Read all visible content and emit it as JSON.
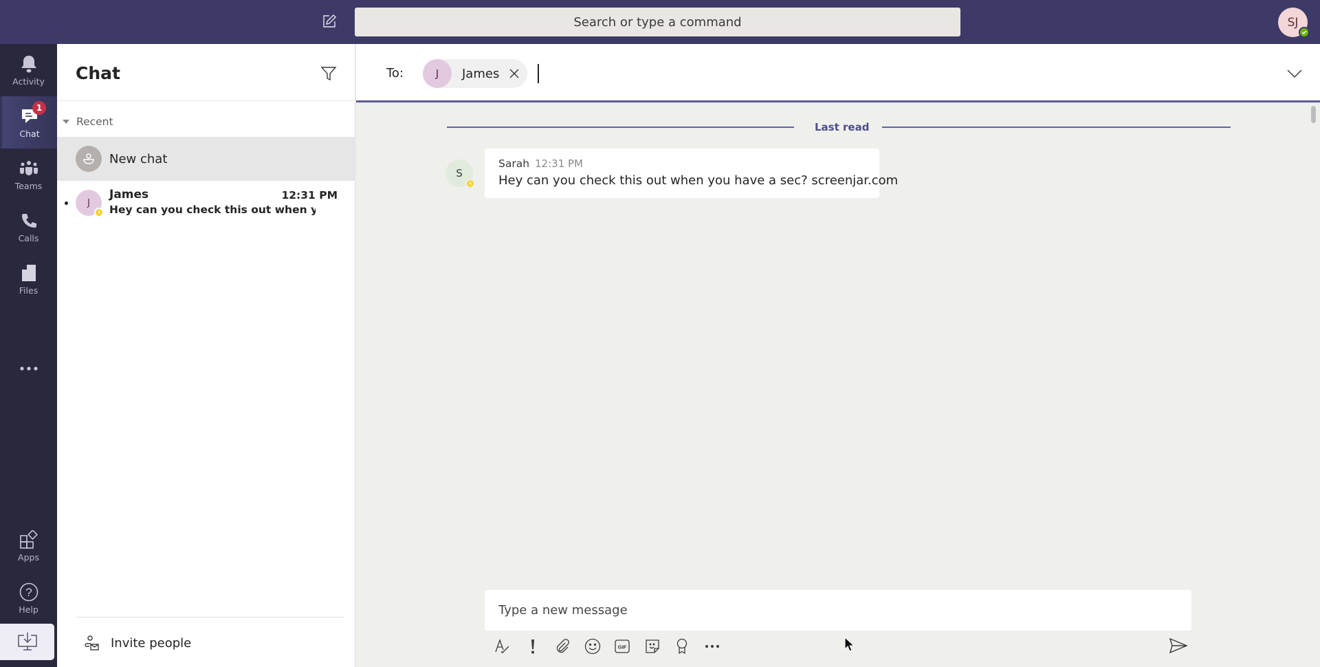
{
  "header": {
    "search_placeholder": "Search or type a command",
    "compose_icon": "new-chat-compose-icon",
    "user_initials": "SJ",
    "user_status": "available"
  },
  "rail": {
    "items": [
      {
        "id": "activity",
        "label": "Activity",
        "icon": "bell-icon"
      },
      {
        "id": "chat",
        "label": "Chat",
        "icon": "chat-icon",
        "badge": "1",
        "active": true
      },
      {
        "id": "teams",
        "label": "Teams",
        "icon": "teams-icon"
      },
      {
        "id": "calls",
        "label": "Calls",
        "icon": "phone-icon"
      },
      {
        "id": "files",
        "label": "Files",
        "icon": "file-icon"
      }
    ],
    "more_icon": "ellipsis-icon",
    "bottom_items": [
      {
        "id": "apps",
        "label": "Apps",
        "icon": "apps-icon"
      },
      {
        "id": "help",
        "label": "Help",
        "icon": "help-icon"
      }
    ],
    "download_icon": "download-desktop-icon"
  },
  "list": {
    "title": "Chat",
    "section_label": "Recent",
    "new_chat_label": "New chat",
    "chats": [
      {
        "initial": "J",
        "name": "James",
        "time": "12:31 PM",
        "preview": "Hey can you check this out when yo...",
        "unread": true,
        "status": "away"
      }
    ],
    "invite_label": "Invite people"
  },
  "conversation": {
    "to_label": "To:",
    "recipients": [
      {
        "initial": "J",
        "name": "James"
      }
    ],
    "to_input_value": "",
    "last_read_label": "Last read",
    "messages": [
      {
        "initial": "S",
        "author": "Sarah",
        "time": "12:31 PM",
        "text": "Hey can you check this out when you have a sec? screenjar.com",
        "status": "away"
      }
    ],
    "compose_placeholder": "Type a new message",
    "toolbar": [
      "format-icon",
      "important-icon",
      "attach-icon",
      "emoji-icon",
      "gif-icon",
      "sticker-icon",
      "praise-icon",
      "more-options-icon"
    ],
    "send_icon": "send-icon"
  },
  "colors": {
    "header_bg": "#3d3a67",
    "rail_bg": "#2a283d",
    "accent": "#6264a7",
    "badge": "#c4314b",
    "away": "#f8d22a",
    "available": "#6bb700"
  }
}
